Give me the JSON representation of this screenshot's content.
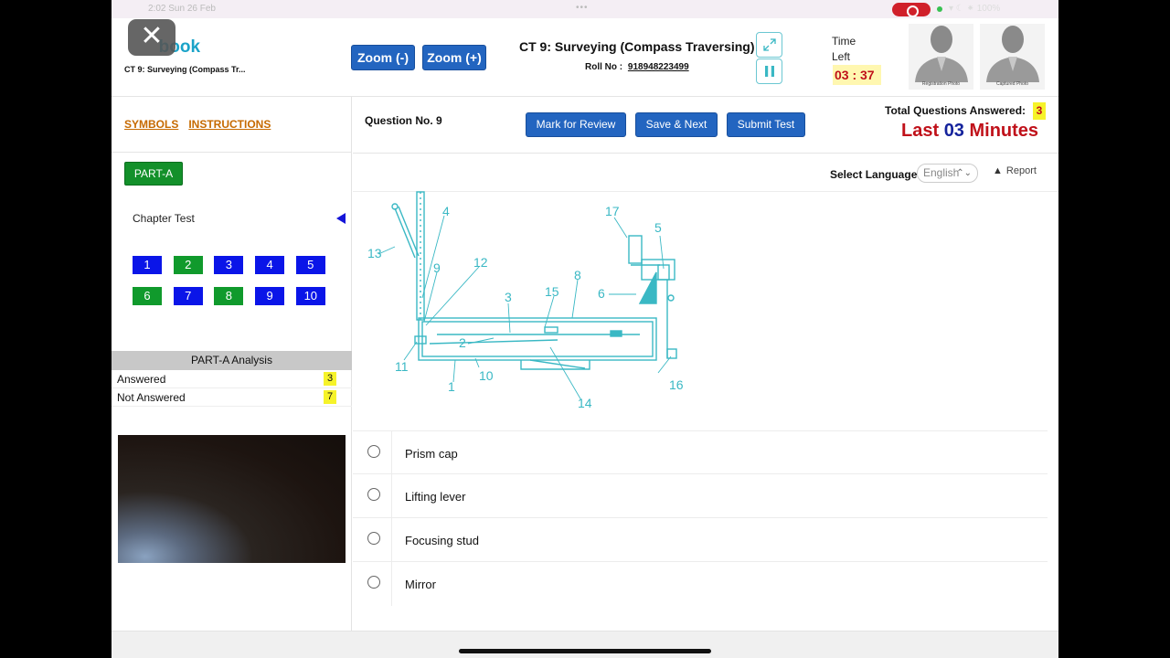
{
  "statusbar": {
    "time": "2:02  Sun 26 Feb",
    "dots": "•••",
    "right": "▾ ☾ ⁕ 100%"
  },
  "header": {
    "logo": "book",
    "test_subtitle": "CT 9: Surveying (Compass Tr...",
    "zoom_minus": "Zoom (-)",
    "zoom_plus": "Zoom (+)",
    "test_title": "CT 9: Surveying (Compass Traversing)",
    "roll_label": "Roll No :",
    "roll_number": "918948223499",
    "time_left_label": "Time Left",
    "time_left_value": "03 : 37",
    "registration_photo": "Registration Photo",
    "captured_photo": "Captured Photo",
    "close_glyph": "✕"
  },
  "left": {
    "symbols": "SYMBOLS",
    "instructions": "INSTRUCTIONS",
    "part": "PART-A",
    "chapter": "Chapter Test",
    "questions": [
      {
        "n": "1",
        "status": "not"
      },
      {
        "n": "2",
        "status": "ans"
      },
      {
        "n": "3",
        "status": "not"
      },
      {
        "n": "4",
        "status": "not"
      },
      {
        "n": "5",
        "status": "not"
      },
      {
        "n": "6",
        "status": "ans"
      },
      {
        "n": "7",
        "status": "not"
      },
      {
        "n": "8",
        "status": "ans"
      },
      {
        "n": "9",
        "status": "not"
      },
      {
        "n": "10",
        "status": "not"
      }
    ],
    "analysis_title": "PART-A Analysis",
    "answered_label": "Answered",
    "answered_count": "3",
    "not_answered_label": "Not Answered",
    "not_answered_count": "7"
  },
  "toolbar": {
    "question_no": "Question No. 9",
    "mark_review": "Mark for Review",
    "save_next": "Save & Next",
    "submit": "Submit Test",
    "total_answered_label": "Total Questions Answered:",
    "total_answered_count": "3",
    "last_prefix": "Last",
    "last_value": "03",
    "last_suffix": "Minutes"
  },
  "language": {
    "label": "Select Language",
    "selected": "English",
    "report": "Report"
  },
  "figure": {
    "labels": [
      "1",
      "2",
      "3",
      "4",
      "5",
      "6",
      "8",
      "9",
      "10",
      "11",
      "12",
      "13",
      "14",
      "15",
      "16",
      "17"
    ]
  },
  "options": [
    "Prism cap",
    "Lifting lever",
    "Focusing stud",
    "Mirror"
  ],
  "colors": {
    "primary_button": "#2365c0",
    "answered": "#109a2c",
    "not_answered": "#0a15e8",
    "timer": "#c0111a",
    "diagram": "#3ab8c4"
  }
}
